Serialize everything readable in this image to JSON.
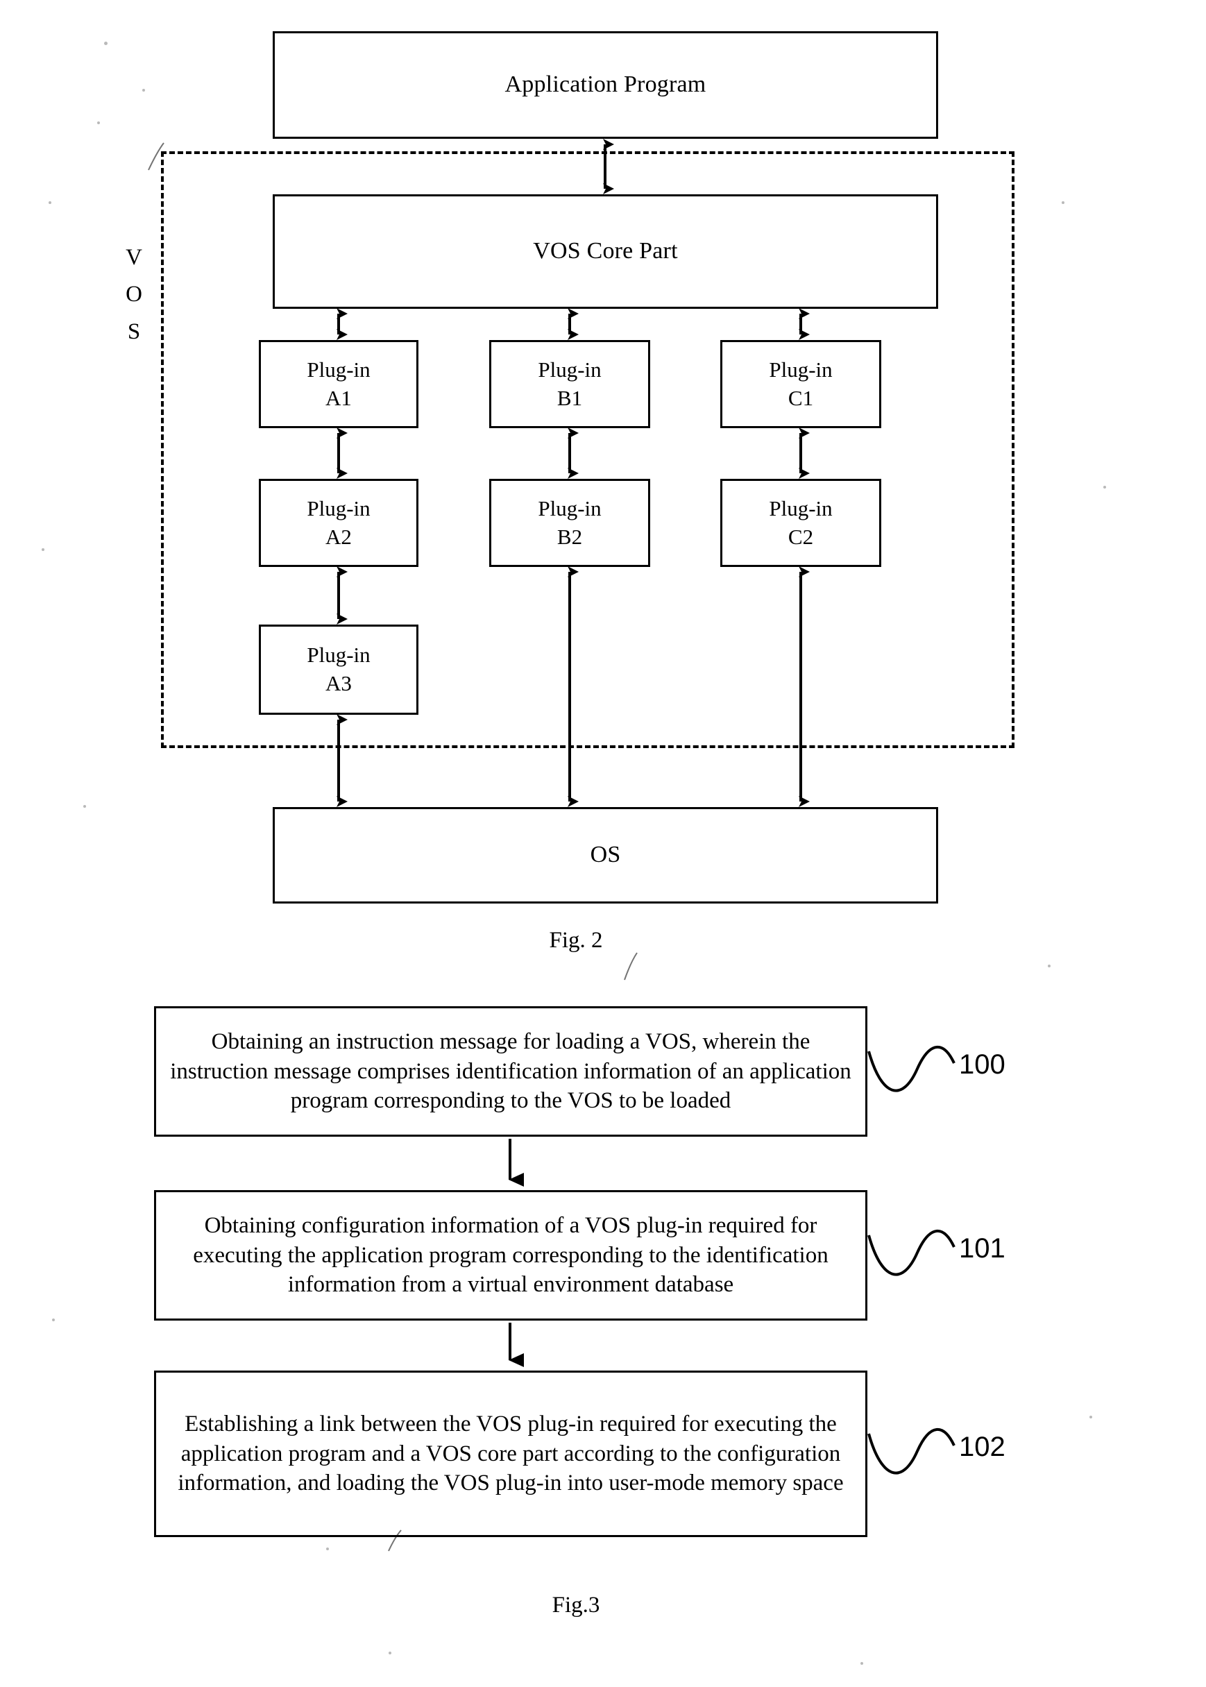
{
  "figure2": {
    "caption": "Fig. 2",
    "application_program": "Application Program",
    "vos_core_part": "VOS Core Part",
    "os": "OS",
    "vos_label_letters": [
      "V",
      "O",
      "S"
    ],
    "columns": [
      {
        "name": "A",
        "plugins": [
          {
            "line1": "Plug-in",
            "line2": "A1"
          },
          {
            "line1": "Plug-in",
            "line2": "A2"
          },
          {
            "line1": "Plug-in",
            "line2": "A3"
          }
        ]
      },
      {
        "name": "B",
        "plugins": [
          {
            "line1": "Plug-in",
            "line2": "B1"
          },
          {
            "line1": "Plug-in",
            "line2": "B2"
          }
        ]
      },
      {
        "name": "C",
        "plugins": [
          {
            "line1": "Plug-in",
            "line2": "C1"
          },
          {
            "line1": "Plug-in",
            "line2": "C2"
          }
        ]
      }
    ]
  },
  "figure3": {
    "caption": "Fig.3",
    "steps": [
      {
        "ref": "100",
        "text": "Obtaining an instruction message for loading a VOS, wherein the instruction message comprises identification information of an application program corresponding to the VOS to be loaded"
      },
      {
        "ref": "101",
        "text": "Obtaining configuration information of a VOS plug-in required for executing the application program corresponding to the identification information from a virtual environment database"
      },
      {
        "ref": "102",
        "text": "Establishing a link between the VOS plug-in required for executing the application program and a VOS core part according to the configuration information, and loading the VOS plug-in into user-mode memory space"
      }
    ]
  },
  "colors": {
    "ink": "#000000",
    "paper": "#ffffff"
  }
}
